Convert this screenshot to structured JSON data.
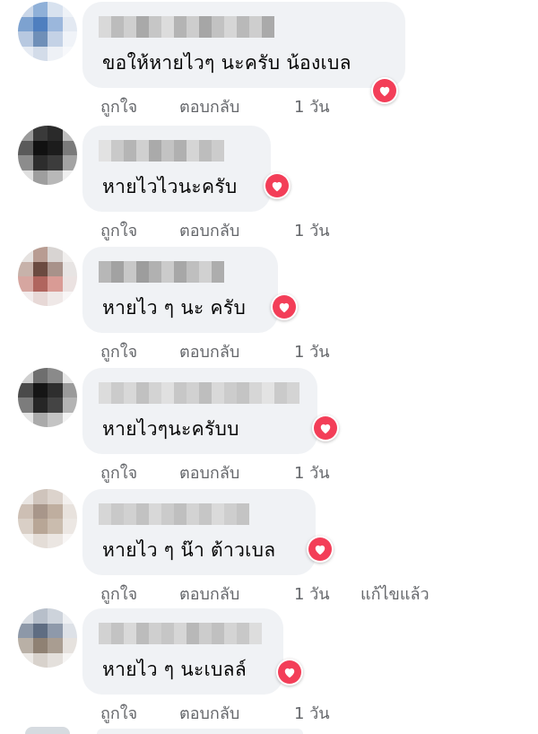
{
  "colors": {
    "bubble": "#f0f2f5",
    "text": "#050505",
    "meta": "#65676b",
    "reaction_love": "#f33e58"
  },
  "comments": [
    {
      "text": "ขอให้หายไวๆ นะครับ น้องเบล",
      "reaction": "love-reaction",
      "actions": {
        "like": "ถูกใจ",
        "reply": "ตอบกลับ",
        "time": "1 วัน",
        "edited": ""
      }
    },
    {
      "text": "หายไวไวนะครับ",
      "reaction": "love-reaction",
      "actions": {
        "like": "ถูกใจ",
        "reply": "ตอบกลับ",
        "time": "1 วัน",
        "edited": ""
      }
    },
    {
      "text": "หายไว ๆ นะ ครับ",
      "reaction": "love-reaction",
      "actions": {
        "like": "ถูกใจ",
        "reply": "ตอบกลับ",
        "time": "1 วัน",
        "edited": ""
      }
    },
    {
      "text": "หายไวๆนะครับบ",
      "reaction": "love-reaction",
      "actions": {
        "like": "ถูกใจ",
        "reply": "ตอบกลับ",
        "time": "1 วัน",
        "edited": ""
      }
    },
    {
      "text": "หายไว ๆ น๊า ต้าวเบล",
      "reaction": "love-reaction",
      "actions": {
        "like": "ถูกใจ",
        "reply": "ตอบกลับ",
        "time": "1 วัน",
        "edited": "แก้ไขแล้ว"
      }
    },
    {
      "text": "หายไว ๆ นะเบลล์",
      "reaction": "love-reaction",
      "actions": {
        "like": "ถูกใจ",
        "reply": "ตอบกลับ",
        "time": "1 วัน",
        "edited": ""
      }
    }
  ]
}
